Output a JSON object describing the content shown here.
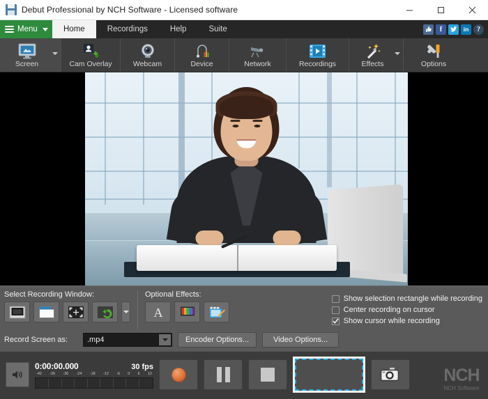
{
  "window": {
    "title": "Debut Professional by NCH Software - Licensed software",
    "icon": "save-disk-icon",
    "controls": {
      "minimize": "minimize-icon",
      "maximize": "maximize-icon",
      "close": "close-icon"
    }
  },
  "menubar": {
    "menu_label": "Menu",
    "tabs": [
      {
        "label": "Home",
        "active": true
      },
      {
        "label": "Recordings",
        "active": false
      },
      {
        "label": "Help",
        "active": false
      },
      {
        "label": "Suite",
        "active": false
      }
    ],
    "socials": [
      {
        "name": "thumbs-up-icon",
        "glyph": "☝"
      },
      {
        "name": "facebook-icon",
        "glyph": "f"
      },
      {
        "name": "twitter-icon",
        "glyph": "t"
      },
      {
        "name": "linkedin-icon",
        "glyph": "in"
      },
      {
        "name": "help-icon",
        "glyph": "?"
      }
    ]
  },
  "ribbon": {
    "items": [
      {
        "label": "Screen",
        "icon": "monitor-icon",
        "dropdown": true,
        "selected": true
      },
      {
        "label": "Cam Overlay",
        "icon": "cam-overlay-icon",
        "dropdown": false,
        "selected": false
      },
      {
        "label": "Webcam",
        "icon": "webcam-icon",
        "dropdown": false,
        "selected": false
      },
      {
        "label": "Device",
        "icon": "device-icon",
        "dropdown": false,
        "selected": false
      },
      {
        "label": "Network",
        "icon": "network-cam-icon",
        "dropdown": false,
        "selected": false
      },
      {
        "label": "Recordings",
        "icon": "film-play-icon",
        "dropdown": false,
        "selected": false
      },
      {
        "label": "Effects",
        "icon": "magic-wand-icon",
        "dropdown": true,
        "selected": false
      },
      {
        "label": "Options",
        "icon": "tools-icon",
        "dropdown": false,
        "selected": false
      }
    ]
  },
  "preview": {
    "name": "video-preview",
    "description": "Webcam preview: smiling woman in dark suit at desk with open book and laptop, office windows behind"
  },
  "panel": {
    "recording_window": {
      "label": "Select Recording Window:",
      "buttons": [
        {
          "name": "full-screen-button",
          "title": "Screen"
        },
        {
          "name": "window-button",
          "title": "Window"
        },
        {
          "name": "region-button",
          "title": "Region"
        },
        {
          "name": "last-region-button",
          "title": "Custom"
        }
      ],
      "has_dropdown": true
    },
    "optional_effects": {
      "label": "Optional Effects:",
      "buttons": [
        {
          "name": "text-caption-button",
          "title": "A"
        },
        {
          "name": "color-effects-button",
          "title": "Color"
        },
        {
          "name": "overlay-effects-button",
          "title": "Overlay"
        }
      ]
    },
    "checkboxes": [
      {
        "label": "Show selection rectangle while recording",
        "checked": false
      },
      {
        "label": "Center recording on cursor",
        "checked": false
      },
      {
        "label": "Show cursor while recording",
        "checked": true
      }
    ],
    "format_row": {
      "label": "Record Screen as:",
      "format_value": ".mp4",
      "encoder_button": "Encoder Options...",
      "video_button": "Video Options..."
    }
  },
  "transport": {
    "volume_icon": "speaker-icon",
    "time": "0:00:00.000",
    "fps": "30 fps",
    "meter_scale": [
      "-42",
      "-36",
      "-30",
      "-24",
      "-18",
      "-12",
      "-6",
      "0",
      "6",
      "12"
    ],
    "buttons": [
      {
        "name": "record-button",
        "icon": "record-icon"
      },
      {
        "name": "pause-button",
        "icon": "pause-icon"
      },
      {
        "name": "stop-button",
        "icon": "stop-icon"
      },
      {
        "name": "selection-preview",
        "icon": "selection-rectangle-icon"
      },
      {
        "name": "snapshot-button",
        "icon": "camera-icon"
      }
    ],
    "brand": {
      "logo": "NCH",
      "name": "NCH Software"
    }
  },
  "colors": {
    "menu_green": "#2e8b3d",
    "ribbon_bg": "#3d3d3d",
    "panel_bg": "#5a5a5a",
    "transport_bg": "#3b3b3b",
    "record_orange": "#d2622c",
    "selection_blue": "#2aa9e0"
  }
}
